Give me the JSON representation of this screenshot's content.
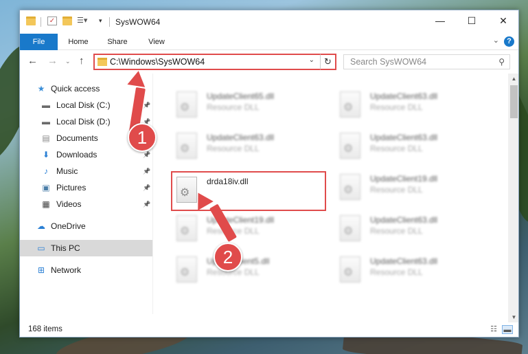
{
  "window": {
    "title": "SysWOW64",
    "minimize": "—",
    "maximize": "☐",
    "close": "✕"
  },
  "ribbon": {
    "tabs": [
      "File",
      "Home",
      "Share",
      "View"
    ],
    "help": "?"
  },
  "nav": {
    "address": "C:\\Windows\\SysWOW64",
    "search_placeholder": "Search SysWOW64"
  },
  "sidebar": {
    "items": [
      {
        "label": "Quick access",
        "icon": "star-icon",
        "glyph": "★",
        "color": "#3b8fd8"
      },
      {
        "label": "Local Disk (C:)",
        "icon": "drive-icon",
        "glyph": "▬",
        "color": "#6a6a6a",
        "pinned": true
      },
      {
        "label": "Local Disk (D:)",
        "icon": "drive-icon",
        "glyph": "▬",
        "color": "#6a6a6a",
        "pinned": true
      },
      {
        "label": "Documents",
        "icon": "document-icon",
        "glyph": "▤",
        "color": "#8a8a8a",
        "pinned": true
      },
      {
        "label": "Downloads",
        "icon": "download-icon",
        "glyph": "⬇",
        "color": "#2a7fd4",
        "pinned": true
      },
      {
        "label": "Music",
        "icon": "music-icon",
        "glyph": "♪",
        "color": "#2a7fd4",
        "pinned": true
      },
      {
        "label": "Pictures",
        "icon": "picture-icon",
        "glyph": "▣",
        "color": "#4b7ea8",
        "pinned": true
      },
      {
        "label": "Videos",
        "icon": "video-icon",
        "glyph": "▦",
        "color": "#444",
        "pinned": true
      },
      {
        "label": "OneDrive",
        "icon": "cloud-icon",
        "glyph": "☁",
        "color": "#2a7fd4"
      },
      {
        "label": "This PC",
        "icon": "computer-icon",
        "glyph": "▭",
        "color": "#2a7fd4",
        "selected": true
      },
      {
        "label": "Network",
        "icon": "network-icon",
        "glyph": "⊞",
        "color": "#2a7fd4"
      }
    ]
  },
  "files": [
    {
      "name": "UpdateClient65.dll",
      "type": "Resource DLL",
      "blur": true
    },
    {
      "name": "UpdateClient63.dll",
      "type": "Resource DLL",
      "blur": true
    },
    {
      "name": "UpdateClient63.dll",
      "type": "Resource DLL",
      "blur": true
    },
    {
      "name": "UpdateClient63.dll",
      "type": "Resource DLL",
      "blur": true
    },
    {
      "name": "drda18iv.dll",
      "type": "",
      "blur": false,
      "highlight": true
    },
    {
      "name": "UpdateClient19.dll",
      "type": "Resource DLL",
      "blur": true
    },
    {
      "name": "UpdateClient19.dll",
      "type": "Resource DLL",
      "blur": true
    },
    {
      "name": "UpdateClient63.dll",
      "type": "Resource DLL",
      "blur": true
    },
    {
      "name": "UpdateClient5.dll",
      "type": "Resource DLL",
      "blur": true
    },
    {
      "name": "UpdateClient63.dll",
      "type": "Resource DLL",
      "blur": true
    }
  ],
  "status": {
    "item_count": "168 items"
  },
  "annotations": {
    "badge1": "1",
    "badge2": "2",
    "color": "#e04b4b"
  }
}
